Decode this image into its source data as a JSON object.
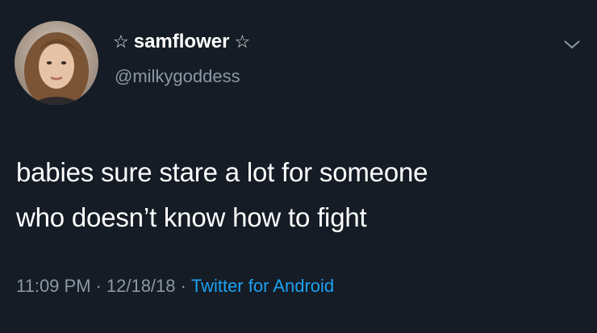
{
  "user": {
    "display_name": "samflower",
    "name_decoration_left": "☆",
    "name_decoration_right": "☆",
    "handle": "@milkygoddess"
  },
  "tweet": {
    "text_lines": [
      "babies sure stare a lot for someone",
      "who doesn’t know how to fight"
    ]
  },
  "meta": {
    "time": "11:09 PM",
    "separator": "·",
    "date": "12/18/18",
    "source": "Twitter for Android"
  },
  "icons": {
    "menu": "chevron-down-icon",
    "avatar": "profile-photo"
  },
  "colors": {
    "background": "#151c25",
    "text": "#ffffff",
    "secondary": "#8b98a5",
    "link": "#1da1f2"
  }
}
